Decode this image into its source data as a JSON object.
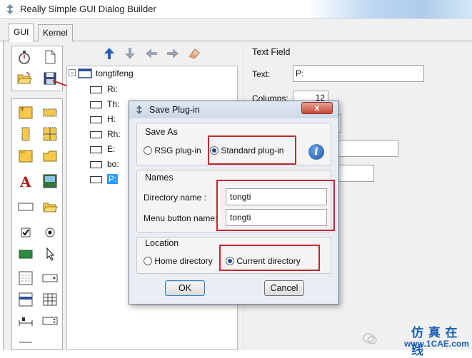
{
  "window": {
    "title": "Really Simple GUI Dialog Builder"
  },
  "tabs": [
    {
      "label": "GUI"
    },
    {
      "label": "Kernel"
    }
  ],
  "tree": {
    "root": "tongtifeng",
    "items": [
      "Ri:",
      "Th:",
      "H:",
      "Rh:",
      "E:",
      "bo:",
      "P:"
    ]
  },
  "properties": {
    "section_title": "Text Field",
    "text_label": "Text:",
    "text_value": "P:",
    "columns_label": "Columns:",
    "columns_value": "12"
  },
  "dialog": {
    "title": "Save Plug-in",
    "close_label": "x",
    "save_as": {
      "title": "Save As",
      "option_rsg": "RSG plug-in",
      "option_standard": "Standard plug-in",
      "selected": "Standard plug-in"
    },
    "names": {
      "title": "Names",
      "directory_label": "Directory name :",
      "directory_value": "tongti",
      "menu_label": "Menu button name:",
      "menu_value": "tongti"
    },
    "location": {
      "title": "Location",
      "option_home": "Home directory",
      "option_current": "Current directory",
      "selected": "Current directory"
    },
    "ok_label": "OK",
    "cancel_label": "Cancel"
  },
  "watermark": {
    "line1": "仿 真 在 线",
    "line2": "www.1CAE.com"
  },
  "colors": {
    "highlight": "#c0282d",
    "accent": "#1a4d9c",
    "selection": "#3399ff"
  }
}
